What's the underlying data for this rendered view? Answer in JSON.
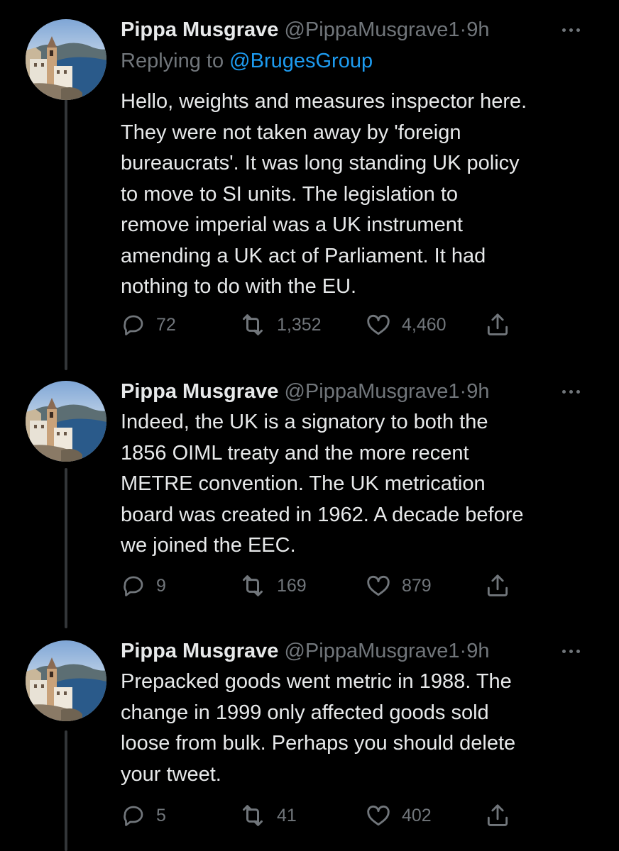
{
  "tweets": [
    {
      "name": "Pippa Musgrave",
      "handle": "@PippaMusgrave1",
      "separator": "·",
      "time": "9h",
      "replying_prefix": "Replying to ",
      "replying_to": "@BrugesGroup",
      "text": "Hello, weights and measures inspector here.\nThey were not taken away by 'foreign\nbureaucrats'. It was long standing UK policy\nto move to SI units.  The legislation to\nremove imperial was a UK instrument\namending a UK act of Parliament. It had\nnothing to do with the EU.",
      "replies": "72",
      "retweets": "1,352",
      "likes": "4,460"
    },
    {
      "name": "Pippa Musgrave",
      "handle": "@PippaMusgrave1",
      "separator": "·",
      "time": "9h",
      "text": "Indeed, the UK is a signatory to both the\n1856 OIML treaty and the more recent\nMETRE convention. The UK metrication\nboard was created in 1962. A decade before\nwe joined the EEC.",
      "replies": "9",
      "retweets": "169",
      "likes": "879"
    },
    {
      "name": "Pippa Musgrave",
      "handle": "@PippaMusgrave1",
      "separator": "·",
      "time": "9h",
      "text": "Prepacked goods went metric in 1988. The\nchange in 1999 only affected goods sold\nloose from bulk. Perhaps you should delete\nyour tweet.",
      "replies": "5",
      "retweets": "41",
      "likes": "402"
    }
  ],
  "icons": {
    "reply": "reply-icon",
    "retweet": "retweet-icon",
    "like": "heart-icon",
    "share": "share-icon",
    "more": "more-icon"
  },
  "colors": {
    "background": "#000000",
    "text": "#e7e9ea",
    "secondary": "#71767b",
    "link": "#1d9bf0",
    "thread_line": "#333639"
  }
}
